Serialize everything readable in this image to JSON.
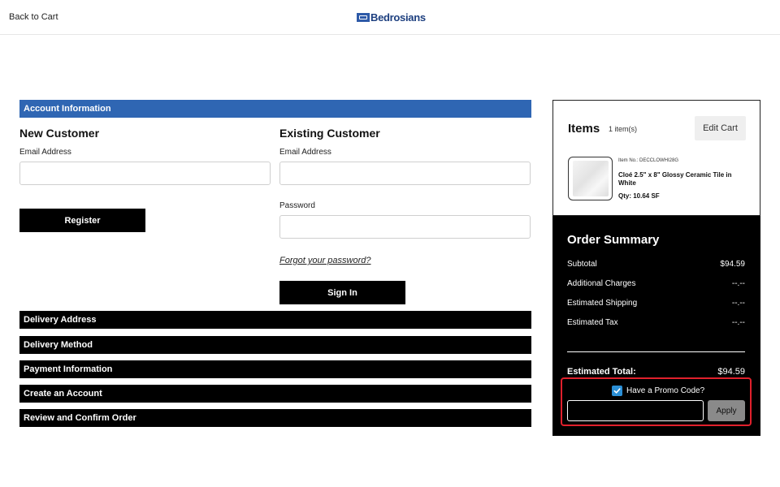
{
  "header": {
    "back_label": "Back to Cart",
    "brand": "Bedrosians",
    "brand_color": "#2e5aa8"
  },
  "account": {
    "section_title": "Account Information",
    "new_customer": {
      "title": "New Customer",
      "email_label": "Email Address",
      "email_value": "",
      "register_label": "Register"
    },
    "existing_customer": {
      "title": "Existing Customer",
      "email_label": "Email Address",
      "email_value": "",
      "password_label": "Password",
      "password_value": "",
      "forgot_label": "Forgot your password?",
      "signin_label": "Sign In"
    }
  },
  "sections": [
    "Delivery Address",
    "Delivery Method",
    "Payment Information",
    "Create an Account",
    "Review and Confirm Order"
  ],
  "cart": {
    "title": "Items",
    "count": "1 item(s)",
    "edit_label": "Edit Cart",
    "item": {
      "item_no": "Item No.: DECCLOWHI28G",
      "name": "Cloé 2.5\" x 8\" Glossy Ceramic Tile in White",
      "qty": "Qty: 10.64 SF"
    }
  },
  "summary": {
    "title": "Order Summary",
    "rows": [
      {
        "label": "Subtotal",
        "value": "$94.59"
      },
      {
        "label": "Additional Charges",
        "value": "--.--"
      },
      {
        "label": "Estimated Shipping",
        "value": "--.--"
      },
      {
        "label": "Estimated Tax",
        "value": "--.--"
      }
    ],
    "total_label": "Estimated Total:",
    "total_value": "$94.59",
    "promo_label": "Have a Promo Code?",
    "promo_checked": true,
    "promo_value": "",
    "apply_label": "Apply",
    "highlight_color": "#e0202c"
  }
}
